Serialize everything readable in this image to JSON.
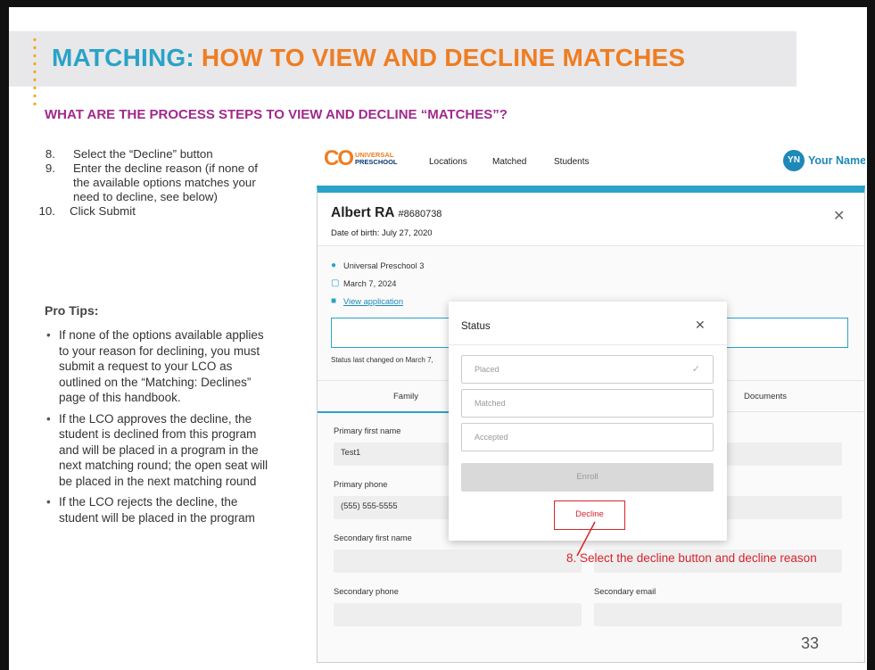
{
  "slide": {
    "title_part1": "MATCHING:",
    "title_part2": "HOW TO VIEW AND DECLINE MATCHES",
    "subtitle": "WHAT ARE THE PROCESS STEPS TO VIEW AND DECLINE “MATCHES”?",
    "steps": [
      {
        "num": "8.",
        "text": "Select the “Decline” button"
      },
      {
        "num": "9.",
        "text": "Enter the decline reason (if none of the available options matches your need to decline, see below)"
      },
      {
        "num": "10.",
        "text": "Click Submit"
      }
    ],
    "pro_tips_title": "Pro Tips:",
    "pro_tips": [
      "If none of the options available applies to your reason for declining, you must submit a request to your LCO as outlined on the “Matching: Declines” page of this handbook.",
      "If the LCO approves the decline, the student is declined from this program and will be placed in a program in the next matching round; the open seat will be placed in the next matching round",
      "If the LCO rejects the decline, the student will be placed in the program"
    ],
    "page_number": "33"
  },
  "app": {
    "logo": {
      "mark": "CO",
      "line1": "UNIVERSAL",
      "line2": "PRESCHOOL"
    },
    "nav": {
      "locations": "Locations",
      "matched": "Matched",
      "students": "Students"
    },
    "user": {
      "initials": "YN",
      "name": "Your Name"
    },
    "student": {
      "name": "Albert RA",
      "id": "#8680738",
      "dob": "Date of birth: July 27, 2020",
      "location": "Universal Preschool 3",
      "date": "March 7, 2024",
      "view_application": "View application",
      "status_changed": "Status last changed on March 7,"
    },
    "tabs": {
      "family": "Family",
      "documents": "Documents"
    },
    "fields": {
      "primary_first_name_label": "Primary first name",
      "primary_first_name_value": "Test1",
      "primary_phone_label": "Primary phone",
      "primary_phone_value": "(555) 555-5555",
      "secondary_first_name_label": "Secondary first name",
      "secondary_phone_label": "Secondary phone",
      "secondary_email_label": "Secondary email"
    },
    "modal": {
      "title": "Status",
      "options": [
        "Placed",
        "Matched",
        "Accepted"
      ],
      "enroll_label": "Enroll",
      "decline_label": "Decline"
    },
    "annotation": "8. Select the decline button and decline reason"
  },
  "colors": {
    "accent_blue": "#2aa3c7",
    "accent_orange": "#ef7d22",
    "subtitle_purple": "#a0298c",
    "decline_red": "#d6242a"
  }
}
